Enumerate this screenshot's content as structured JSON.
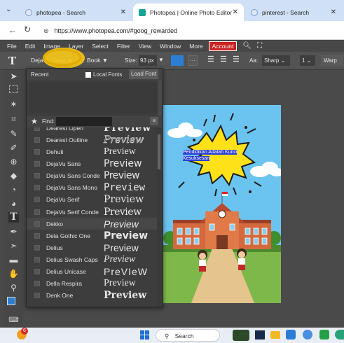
{
  "browser": {
    "tabs": [
      {
        "label": "photopea - Search",
        "active": false
      },
      {
        "label": "Photopea | Online Photo Editor",
        "active": true
      },
      {
        "label": "pinterest - Search",
        "active": false
      }
    ],
    "url": "https://www.photopea.com/#goog_rewarded"
  },
  "menubar": {
    "items": [
      "File",
      "Edit",
      "Image",
      "Layer",
      "Select",
      "Filter",
      "View",
      "Window",
      "More"
    ],
    "account_label": "Account"
  },
  "options": {
    "font_family": "DejaVu Sans",
    "font_style": "Book",
    "size_label": "Size:",
    "size_value": "93 px",
    "aa_label": "Aa:",
    "aa_value": "Sharp",
    "line_value": "1",
    "warp_label": "Warp"
  },
  "font_panel": {
    "tab_recent": "Recent",
    "local_fonts_label": "Local Fonts",
    "load_font_label": "Load Font",
    "find_label": "Find:",
    "find_value": "",
    "fonts": [
      {
        "name": "Dearest Open",
        "preview": "Preview",
        "style": "dearest-open"
      },
      {
        "name": "Dearest Outline",
        "preview": "Preview",
        "style": "outline"
      },
      {
        "name": "Dehuti",
        "preview": "Preview",
        "style": "serif-light"
      },
      {
        "name": "DejaVu Sans",
        "preview": "Preview",
        "style": "sans"
      },
      {
        "name": "DejaVu Sans Conde",
        "preview": "Preview",
        "style": "sans-cond"
      },
      {
        "name": "DejaVu Sans Mono",
        "preview": "Preview",
        "style": "mono"
      },
      {
        "name": "DejaVu Serif",
        "preview": "Preview",
        "style": "serif"
      },
      {
        "name": "DejaVu Serif Conde",
        "preview": "Preview",
        "style": "serif-cond"
      },
      {
        "name": "Dekko",
        "preview": "Preview",
        "style": "hand"
      },
      {
        "name": "Dela Gothic One",
        "preview": "Preview",
        "style": "heavy"
      },
      {
        "name": "Delius",
        "preview": "Preview",
        "style": "rounded"
      },
      {
        "name": "Delius Swash Caps",
        "preview": "Preview",
        "style": "swash"
      },
      {
        "name": "Delius Unicase",
        "preview": "PreVIeW",
        "style": "unicase"
      },
      {
        "name": "Della Respira",
        "preview": "Preview",
        "style": "serif-light"
      },
      {
        "name": "Denk One",
        "preview": "Preview",
        "style": "denk"
      }
    ]
  },
  "canvas": {
    "speech_text": "Pendidikan Adalah Kunci Kesuksesan"
  },
  "taskbar": {
    "search_label": "Search",
    "notification_count": "6"
  },
  "colors": {
    "accent_red": "#cc2222",
    "highlight_yellow": "#f5c518",
    "foreground_swatch": "#2a7fd4",
    "sky": "#6bc4f0"
  }
}
